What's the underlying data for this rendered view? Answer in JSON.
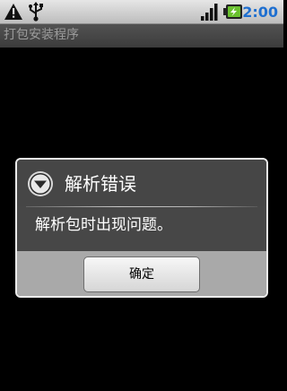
{
  "status_bar": {
    "time": "2:00",
    "icons": [
      "warning-icon",
      "usb-icon",
      "signal-icon",
      "battery-charging-icon"
    ]
  },
  "title_bar": {
    "title": "打包安装程序"
  },
  "dialog": {
    "icon": "alert-circle-icon",
    "title": "解析错误",
    "message": "解析包时出现问题。",
    "ok_label": "确定"
  },
  "colors": {
    "clock": "#1e6fd0",
    "battery": "#6ac12f",
    "dialog_background": "#474747",
    "dialog_footer": "#a9a9a9"
  }
}
